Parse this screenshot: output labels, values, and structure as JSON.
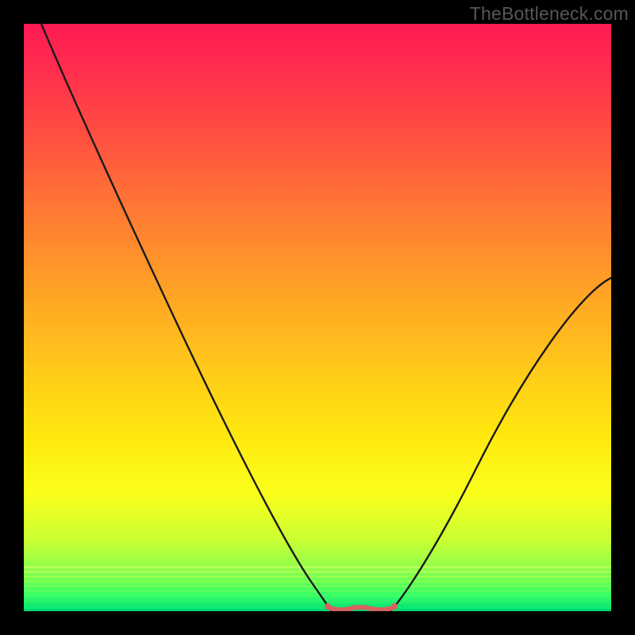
{
  "watermark": "TheBottleneck.com",
  "colors": {
    "frame": "#000000",
    "watermark_text": "#565656",
    "curve_stroke": "#1a1a1a",
    "flat_segment": "#d96060",
    "gradient_top": "#ff1a53",
    "gradient_bottom": "#00e673"
  },
  "chart_data": {
    "type": "line",
    "title": "",
    "xlabel": "",
    "ylabel": "",
    "xlim": [
      0,
      100
    ],
    "ylim": [
      0,
      100
    ],
    "grid": false,
    "legend": false,
    "background": "vertical gradient red→orange→yellow→green with green horizontal banding near bottom",
    "series": [
      {
        "name": "left-branch",
        "x": [
          3,
          10,
          20,
          30,
          40,
          47,
          50,
          52
        ],
        "values": [
          100,
          85,
          64,
          43,
          22,
          8,
          3,
          0
        ]
      },
      {
        "name": "flat-bottom",
        "x": [
          52,
          55,
          58,
          61,
          63
        ],
        "values": [
          0,
          0,
          0,
          0,
          0
        ],
        "stroke": "#d96060",
        "stroke_width": 5
      },
      {
        "name": "right-branch",
        "x": [
          63,
          68,
          75,
          82,
          90,
          100
        ],
        "values": [
          0,
          6,
          16,
          28,
          41,
          57
        ]
      }
    ],
    "annotations": [
      {
        "text": "TheBottleneck.com",
        "position": "top-right",
        "color": "#565656"
      }
    ]
  }
}
